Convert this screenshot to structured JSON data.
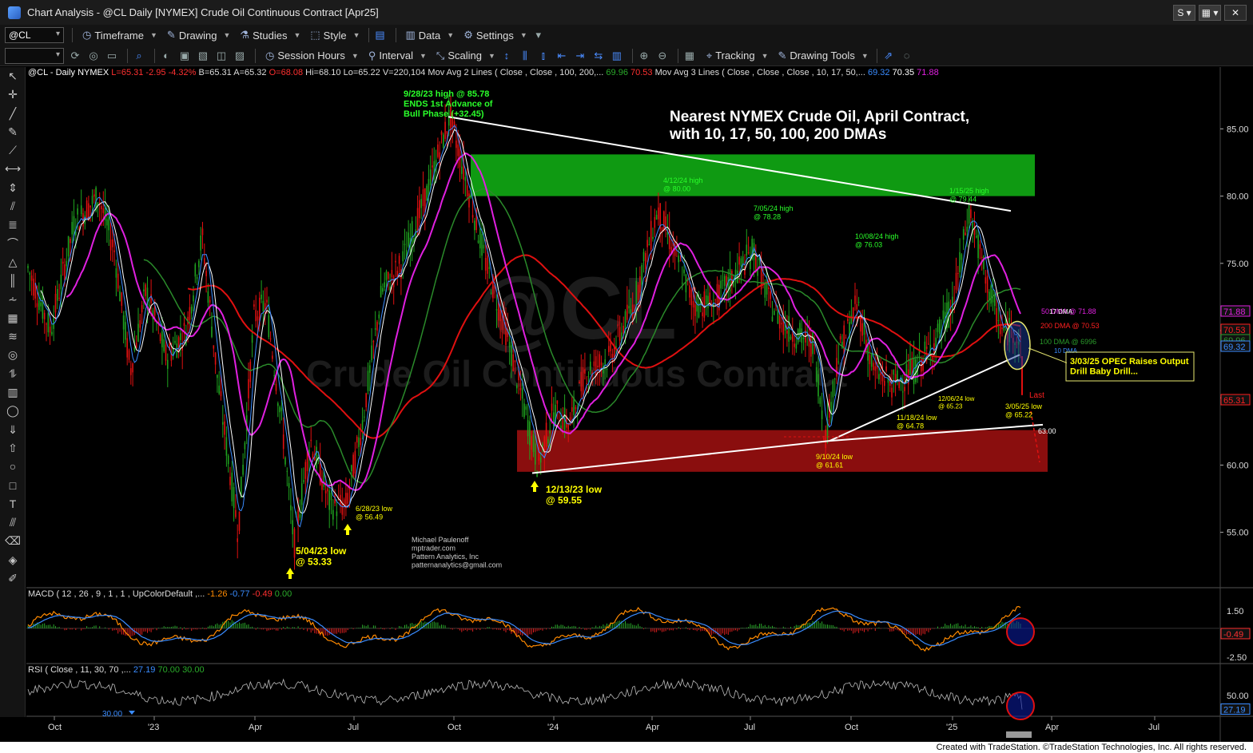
{
  "window": {
    "title": "Chart Analysis - @CL Daily [NYMEX] Crude Oil Continuous Contract [Apr25]",
    "btn_s": "S ▾",
    "btn_grid": "▦ ▾",
    "btn_x": "✕"
  },
  "toolbar1": {
    "symbol": "@CL",
    "items": [
      "Timeframe",
      "Drawing",
      "Studies",
      "Style",
      "Data",
      "Settings"
    ]
  },
  "toolbar2": {
    "items": [
      "Session Hours",
      "Interval",
      "Scaling",
      "Tracking",
      "Drawing Tools"
    ]
  },
  "header": {
    "symbol": "@CL - Daily  NYMEX",
    "last": "L=65.31",
    "chg": "-2.95",
    "pct": "-4.32%",
    "bid": "B=65.31",
    "ask": "A=65.32",
    "open": "O=68.08",
    "hi": "Hi=68.10",
    "lo": "Lo=65.22",
    "vol": "V=220,104",
    "ma2": "Mov Avg 2 Lines (      Close ,      Close ,  100,  200,...",
    "ma2_v1": "69.96",
    "ma2_v2": "70.53",
    "ma3": "Mov Avg 3 Lines (  Close ,  Close ,  Close , 10, 17, 50,...",
    "ma3_v1": "69.32",
    "ma3_v2": "70.35",
    "ma3_v3": "71.88"
  },
  "chart_data": [
    {
      "type": "candlestick",
      "title": "Nearest NYMEX Crude Oil, April Contract, with 10, 17, 50, 100, 200 DMAs",
      "title_line1": "Nearest NYMEX Crude Oil, April Contract,",
      "title_line2": "with 10, 17, 50, 100, 200 DMAs",
      "watermark_symbol": "@CL",
      "watermark_name": "Crude Oil Continuous Contract",
      "x_ticks": [
        "Oct",
        "'23",
        "Apr",
        "Jul",
        "Oct",
        "'24",
        "Apr",
        "Jul",
        "Oct",
        "'25",
        "Apr",
        "Jul"
      ],
      "y_ticks": [
        "85.00",
        "80.00",
        "75.00",
        "70.00",
        "65.00",
        "60.00",
        "55.00"
      ],
      "ylim": [
        51,
        89
      ],
      "price_tags": [
        {
          "text": "71.88",
          "color": "#e020e0"
        },
        {
          "text": "70.53",
          "color": "#ff2020"
        },
        {
          "text": "69.96",
          "color": "#2a9a2a"
        },
        {
          "text": "69.32",
          "color": "#3a8cff"
        },
        {
          "text": "65.31",
          "color": "#ff2020"
        }
      ],
      "annotations": [
        {
          "lines": [
            "9/28/23 high @ 85.78",
            "ENDS 1st Advance of",
            "Bull Phase (+32.45)"
          ],
          "color": "#2aff2a"
        },
        {
          "lines": [
            "4/12/24  high",
            "@ 80.00"
          ],
          "color": "#2aff2a"
        },
        {
          "lines": [
            "7/05/24 high",
            "@ 78.28"
          ],
          "color": "#2aff2a"
        },
        {
          "lines": [
            "10/08/24 high",
            "@ 76.03"
          ],
          "color": "#2aff2a"
        },
        {
          "lines": [
            "1/15/25 high",
            "@ 79.44"
          ],
          "color": "#2aff2a"
        },
        {
          "lines": [
            "50 DMA @ 71.88"
          ],
          "color": "#e020e0"
        },
        {
          "lines": [
            "200 DMA @ 70.53"
          ],
          "color": "#ff2020"
        },
        {
          "lines": [
            "17 DMA"
          ],
          "color": "#ffffff"
        },
        {
          "lines": [
            "100 DMA @ 6996"
          ],
          "color": "#2a9a2a"
        },
        {
          "lines": [
            "10 DMA"
          ],
          "color": "#3a8cff"
        },
        {
          "lines": [
            "3/03/25 OPEC Raises Output",
            "Drill Baby Drill..."
          ],
          "color": "#ffff00"
        },
        {
          "lines": [
            "Last"
          ],
          "color": "#ff2020"
        },
        {
          "lines": [
            "12/06/24 low",
            "@ 65.23"
          ],
          "color": "#ffff00"
        },
        {
          "lines": [
            "3/05/25 low",
            "@ 65.22"
          ],
          "color": "#ffff00"
        },
        {
          "lines": [
            "11/18/24 low",
            "@ 64.78"
          ],
          "color": "#ffff00"
        },
        {
          "lines": [
            "63.00"
          ],
          "color": "#ffffff"
        },
        {
          "lines": [
            "9/10/24 low",
            "@ 61.61"
          ],
          "color": "#ffff00"
        },
        {
          "lines": [
            "12/13/23 low",
            "@ 59.55"
          ],
          "color": "#ffff00"
        },
        {
          "lines": [
            "6/28/23 low",
            "@ 56.49"
          ],
          "color": "#ffff00"
        },
        {
          "lines": [
            "5/04/23 low",
            "@ 53.33"
          ],
          "color": "#ffff00"
        },
        {
          "lines": [
            "Michael Paulenoff",
            "mptrader.com",
            "Pattern Analytics, Inc",
            "patternanalytics@gmail.com"
          ],
          "color": "#cccccc"
        }
      ],
      "resistance_zone": [
        80,
        83.1
      ],
      "support_zone": [
        59.5,
        62.6
      ]
    },
    {
      "type": "line",
      "name": "MACD",
      "header": "MACD ( 12 , 26 , 9 , 1 , 1 , UpColorDefault ,...",
      "values": [
        "-1.26",
        "-0.77",
        "-0.49",
        "0.00"
      ],
      "value_colors": [
        "#ff8a00",
        "#3a8cff",
        "#ff3030",
        "#2aaa2a"
      ],
      "y_ticks": [
        "1.50",
        "-2.50"
      ],
      "last_tag": "-0.49"
    },
    {
      "type": "line",
      "name": "RSI",
      "header": "RSI (  Close ,  11,  30,  70 ,...",
      "values": [
        "27.19",
        "70.00",
        "30.00"
      ],
      "value_colors": [
        "#3a8cff",
        "#2aaa2a",
        "#2aaa2a"
      ],
      "y_ticks": [
        "50.00"
      ],
      "last_tag": "27.19",
      "cut_label": "30.00"
    }
  ],
  "footer": "Created with TradeStation. ©TradeStation Technologies, Inc. All rights reserved."
}
